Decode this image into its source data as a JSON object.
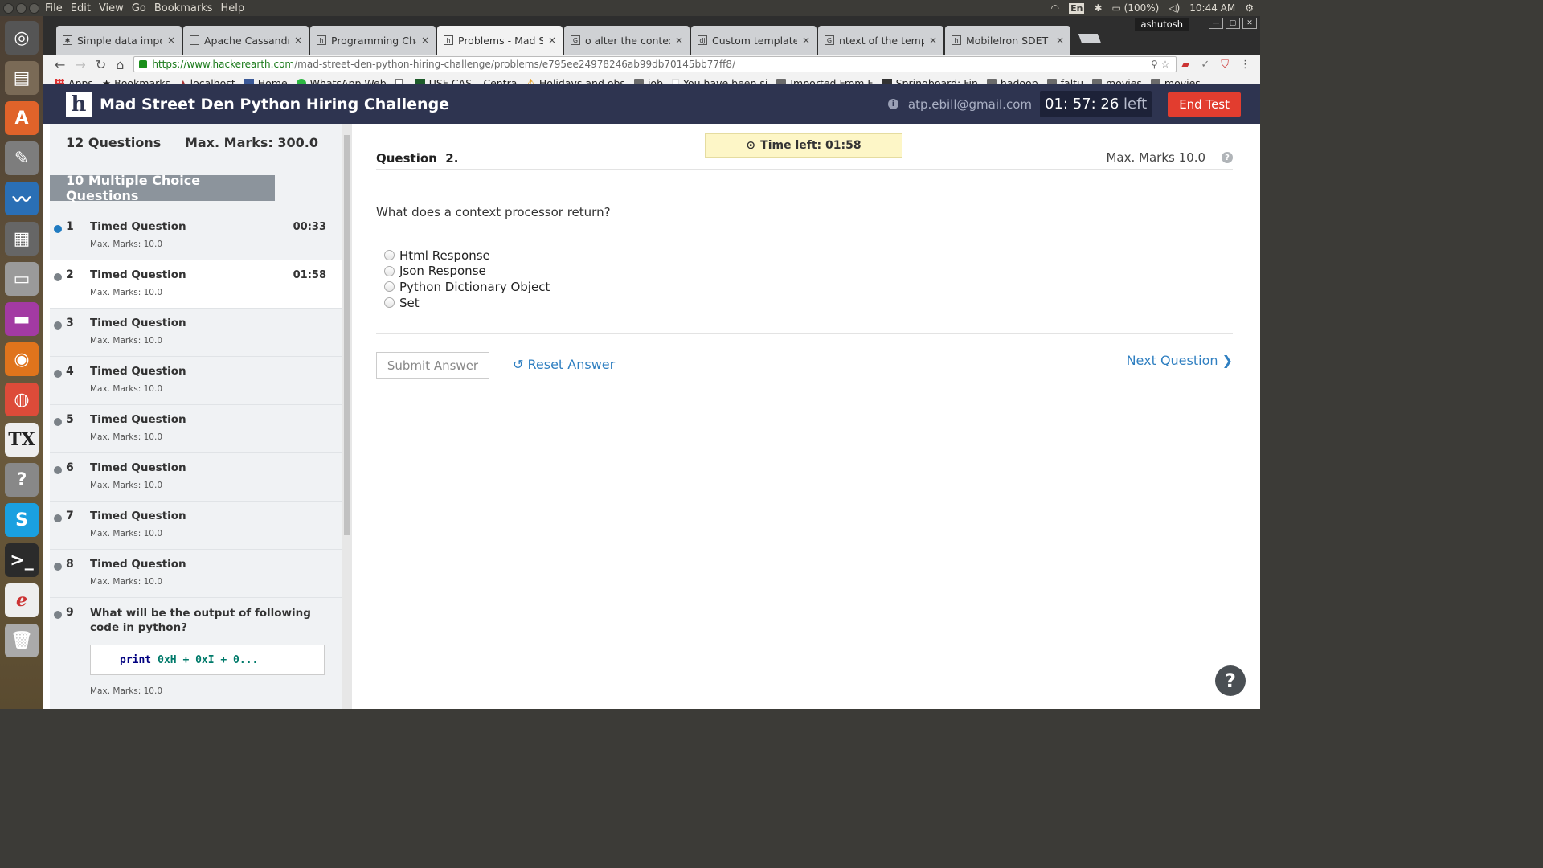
{
  "os": {
    "menu": [
      "File",
      "Edit",
      "View",
      "Go",
      "Bookmarks",
      "Help"
    ],
    "lang": "En",
    "battery": "(100%)",
    "time": "10:44 AM"
  },
  "browser": {
    "profile": "ashutosh",
    "tabs": [
      {
        "label": "Simple data import"
      },
      {
        "label": "Apache Cassandra"
      },
      {
        "label": "Programming Chall"
      },
      {
        "label": "Problems - Mad Str"
      },
      {
        "label": "o alter the context"
      },
      {
        "label": "Custom template t"
      },
      {
        "label": "ntext of the templa"
      },
      {
        "label": "MobileIron SDET H"
      }
    ],
    "url_host": "https://www.hackerearth.com",
    "url_path": "/mad-street-den-python-hiring-challenge/problems/e795ee24978246ab99db70145bb77ff8/",
    "bookmarks": [
      "Apps",
      "Bookmarks",
      "localhost",
      "Home",
      "WhatsApp Web",
      "",
      "USF CAS – Centra",
      "Holidays and obs",
      "job",
      "You have been si",
      "Imported From F",
      "Springboard: Fin",
      "hadoop",
      "faltu",
      "movies",
      "movies"
    ]
  },
  "header": {
    "logo": "h",
    "title": "Mad Street Den Python Hiring Challenge",
    "email": "atp.ebill@gmail.com",
    "timer": "01: 57: 26",
    "timer_suffix": "left",
    "end_label": "End Test"
  },
  "sidebar": {
    "questions": "12 Questions",
    "max_marks": "Max. Marks: 300.0",
    "section": "10 Multiple Choice Questions",
    "items": [
      {
        "num": "1",
        "title": "Timed Question",
        "time": "00:33",
        "marks": "Max. Marks: 10.0"
      },
      {
        "num": "2",
        "title": "Timed Question",
        "time": "01:58",
        "marks": "Max. Marks: 10.0"
      },
      {
        "num": "3",
        "title": "Timed Question",
        "time": "",
        "marks": "Max. Marks: 10.0"
      },
      {
        "num": "4",
        "title": "Timed Question",
        "time": "",
        "marks": "Max. Marks: 10.0"
      },
      {
        "num": "5",
        "title": "Timed Question",
        "time": "",
        "marks": "Max. Marks: 10.0"
      },
      {
        "num": "6",
        "title": "Timed Question",
        "time": "",
        "marks": "Max. Marks: 10.0"
      },
      {
        "num": "7",
        "title": "Timed Question",
        "time": "",
        "marks": "Max. Marks: 10.0"
      },
      {
        "num": "8",
        "title": "Timed Question",
        "time": "",
        "marks": "Max. Marks: 10.0"
      },
      {
        "num": "9",
        "title": "What will be the output of following code in python?",
        "time": "",
        "marks": "Max. Marks: 10.0",
        "code_kw": "print",
        "code_rest": "0xH + 0xI + 0..."
      }
    ]
  },
  "question": {
    "time_left": "Time left: 01:58",
    "label": "Question",
    "number": "2.",
    "max_marks": "Max. Marks 10.0",
    "text": "What does a context processor return?",
    "options": [
      "Html Response",
      "Json Response",
      "Python Dictionary Object",
      "Set"
    ],
    "submit_label": "Submit Answer",
    "reset_label": "Reset Answer",
    "next_label": "Next Question"
  },
  "colors": {
    "header_bg": "#2e3450",
    "end_button": "#e23d2f",
    "link_blue": "#2f7fc1",
    "timer_highlight": "#fdf6c7"
  }
}
